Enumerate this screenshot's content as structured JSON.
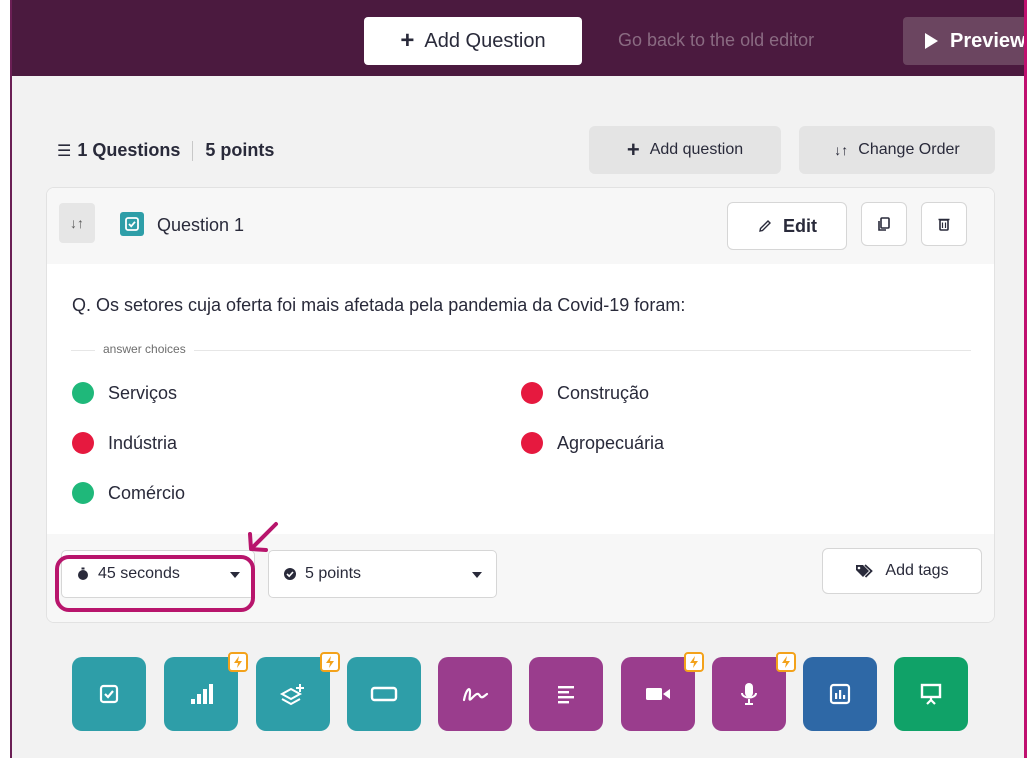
{
  "header": {
    "add_question_label": "Add Question",
    "old_editor_label": "Go back to the old editor",
    "preview_label": "Preview"
  },
  "summary": {
    "questions_label": "1 Questions",
    "points_label": "5 points",
    "add_question_label": "Add question",
    "change_order_label": "Change Order"
  },
  "question": {
    "title": "Question 1",
    "edit_label": "Edit",
    "text": "Q. Os setores cuja oferta foi mais afetada pela pandemia da Covid-19 foram:",
    "answer_choices_label": "answer choices",
    "choices": [
      {
        "label": "Serviços",
        "correct": true
      },
      {
        "label": "Construção",
        "correct": false
      },
      {
        "label": "Indústria",
        "correct": false
      },
      {
        "label": "Agropecuária",
        "correct": false
      },
      {
        "label": "Comércio",
        "correct": true
      }
    ],
    "time_value": "45 seconds",
    "points_value": "5 points",
    "add_tags_label": "Add tags"
  },
  "colors": {
    "header_bg": "#4b1a3f",
    "correct": "#1fb87a",
    "incorrect": "#e6193f",
    "highlight": "#b8156c",
    "teal": "#2e9ea8",
    "purple": "#9a3d8d",
    "blue": "#2e68a6",
    "green": "#10a268",
    "bolt": "#f3a21b"
  },
  "question_types": [
    {
      "icon": "checkbox-icon",
      "color": "teal",
      "premium": false
    },
    {
      "icon": "poll-bars-icon",
      "color": "teal",
      "premium": true
    },
    {
      "icon": "draw-labels-icon",
      "color": "teal",
      "premium": true
    },
    {
      "icon": "fill-blank-icon",
      "color": "teal",
      "premium": false
    },
    {
      "icon": "draw-icon",
      "color": "purple",
      "premium": false
    },
    {
      "icon": "open-ended-icon",
      "color": "purple",
      "premium": false
    },
    {
      "icon": "video-response-icon",
      "color": "purple",
      "premium": true
    },
    {
      "icon": "audio-response-icon",
      "color": "purple",
      "premium": true
    },
    {
      "icon": "chart-slide-icon",
      "color": "blue",
      "premium": false
    },
    {
      "icon": "presentation-slide-icon",
      "color": "green",
      "premium": false
    }
  ]
}
